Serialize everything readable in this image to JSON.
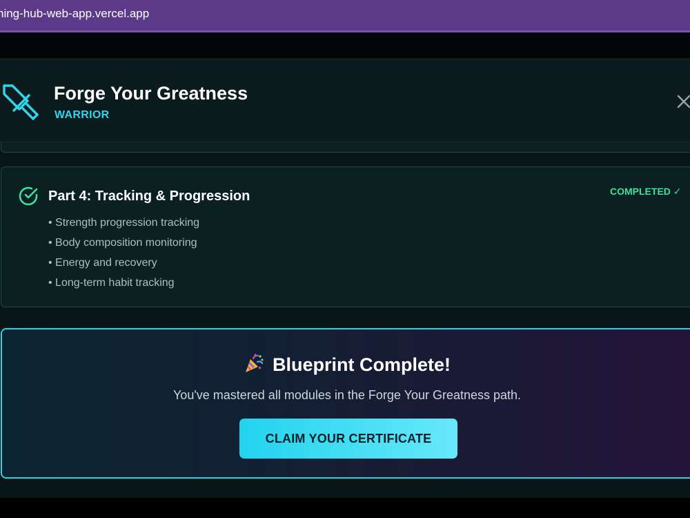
{
  "browser": {
    "url": "ning-hub-web-app.vercel.app"
  },
  "modal": {
    "title": "Forge Your Greatness",
    "subtitle": "WARRIOR",
    "icon": "sword-icon",
    "close_icon": "close-icon"
  },
  "module": {
    "title": "Part 4: Tracking & Progression",
    "status": "COMPLETED ✓",
    "icon": "check-circle-icon",
    "topics": [
      "• Strength progression tracking",
      "• Body composition monitoring",
      "• Energy and recovery",
      "• Long-term habit tracking"
    ]
  },
  "completion": {
    "icon": "party-popper-icon",
    "title": "Blueprint Complete!",
    "message": "You've mastered all modules in the Forge Your Greatness path.",
    "button_label": "CLAIM YOUR CERTIFICATE"
  },
  "colors": {
    "accent": "#22d3ee",
    "success": "#3fe0a0",
    "browser_bar": "#5b3a8a",
    "modal_bg": "#081516"
  }
}
